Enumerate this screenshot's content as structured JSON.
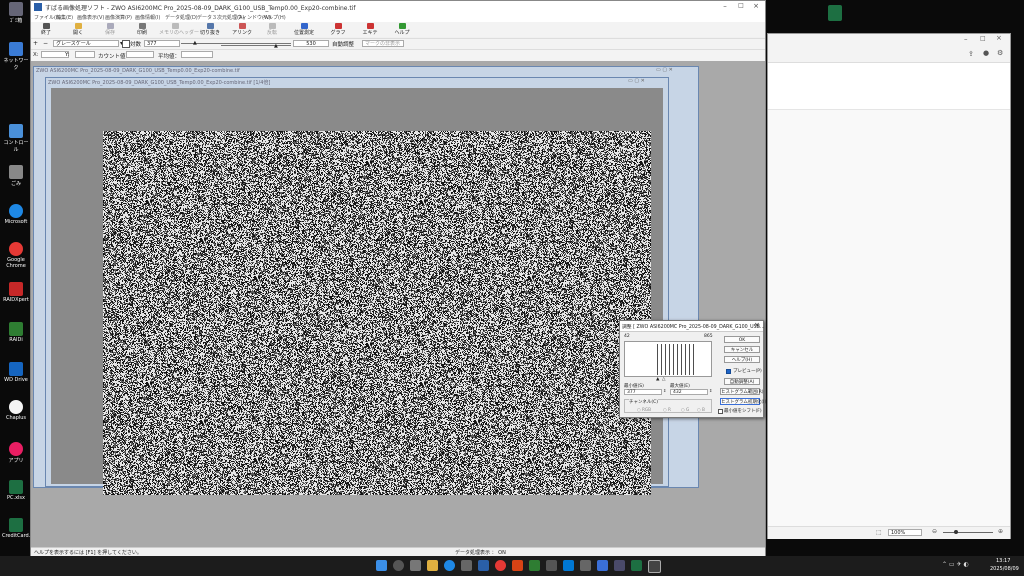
{
  "app": {
    "title": "すばる画像処理ソフト - ZWO ASI6200MC Pro_2025-08-09_DARK_G100_USB_Temp0.00_Exp20-combine.tif",
    "menus": [
      "ファイル(F)",
      "編集(E)",
      "画像表示(V)",
      "画像演算(P)",
      "画像情報(I)",
      "データ処理(D)",
      "データ３次元処理(A)",
      "ウィンドウ(W)",
      "ヘルプ(H)"
    ],
    "tools": [
      "終了",
      "開く",
      "保存",
      "印刷",
      "メモリのヘッダー",
      "切り抜き",
      "アリンク",
      "反転",
      "位置測定",
      "グラフ",
      "エキテ",
      "ヘルプ"
    ],
    "zoom_icons": [
      "+",
      "−"
    ],
    "palette": "グレースケール",
    "log_label": "対数",
    "min_value": "377",
    "max_value": "530",
    "auto_adjust": "自動調整",
    "mark_hide": "マークの非表示",
    "readout": {
      "x_label": "X:",
      "y_label": "Y:",
      "count_label": "カウント値：",
      "avg_label": "平均値："
    },
    "status_left": "ヘルプを表示するには [F1] を押してください。",
    "status_right": "データ処理表示 ： ON"
  },
  "children": [
    {
      "title": "ZWO ASI6200MC Pro_2025-08-09_DARK_G100_USB_Temp0.00_Exp20-combine.tif"
    },
    {
      "title": "ZWO ASI6200MC Pro_2025-08-09_DARK_G100_USB_Temp0.00_Exp20-combine.tif [1/4倍]"
    }
  ],
  "dialog": {
    "title": "調整 [ ZWO ASI6200MC Pro_2025-08-09_DARK_G100_USB...",
    "hist_min": "42",
    "hist_max": "865",
    "ok": "OK",
    "cancel": "キャンセル",
    "help": "ヘルプ(H)",
    "preview": "プレビュー(P)",
    "auto": "自動調整(A)",
    "hist_range": "ヒストグラム範囲(R)",
    "hist_reset": "ヒストグラム初期化(I)",
    "min_label": "最小値(S)",
    "max_label": "最大値(E)",
    "min_value": "377",
    "max_value": "432",
    "channel_label": "チャンネル(C)",
    "channels": [
      "RGB",
      "R",
      "G",
      "B"
    ],
    "fix_min": "最小値をシフト(F)"
  },
  "right_window": {
    "zoom": "100%"
  },
  "desktop_icons": [
    "ｺﾞﾐ箱",
    "ネットワーク",
    "コントロール",
    "ごみ",
    "Microsoft",
    "Google Chrome",
    "RAIDXpert",
    "RAIDi",
    "WD Drive",
    "Chaplus",
    "アプリ",
    "PC.xlsx",
    "CreditCard.xlsx"
  ],
  "taskbar": {
    "time": "13:17",
    "date": "2025/08/09"
  },
  "colors": {
    "desktop": "#0a0a0a",
    "mdi_bg": "#a9a9a9",
    "child_border": "#6a87b0",
    "taskbar": "#1c1c1c"
  }
}
